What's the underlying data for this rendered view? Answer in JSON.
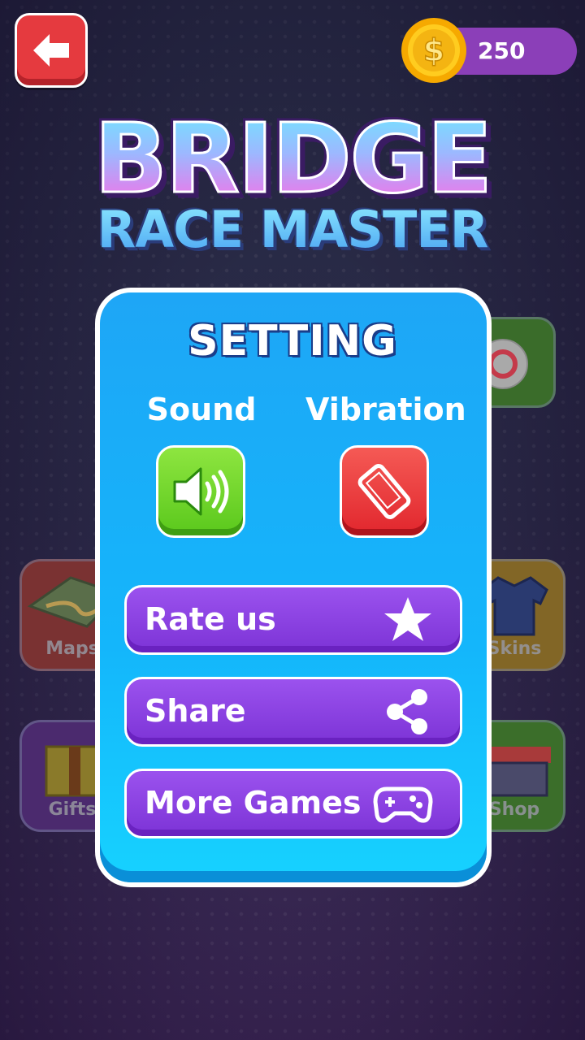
{
  "hud": {
    "coins": "250"
  },
  "logo": {
    "line1": "BRIDGE",
    "line2": "RACE MASTER"
  },
  "background_menu": {
    "maps_label": "Maps",
    "skins_label": "Skins",
    "gifts_label": "Gifts",
    "shop_label": "Shop"
  },
  "settings": {
    "title": "SETTING",
    "sound_label": "Sound",
    "vibration_label": "Vibration",
    "sound_on": true,
    "vibration_on": false,
    "buttons": [
      {
        "label": "Rate us",
        "icon": "star-icon"
      },
      {
        "label": "Share",
        "icon": "share-icon"
      },
      {
        "label": "More Games",
        "icon": "gamepad-icon"
      }
    ]
  },
  "colors": {
    "panel": "#14b6fb",
    "button_purple": "#8a42e2",
    "sound_green": "#6ed02a",
    "vibration_red": "#e53a3f",
    "back_red": "#e53a3f",
    "coin_bar": "#8b3fb8"
  }
}
